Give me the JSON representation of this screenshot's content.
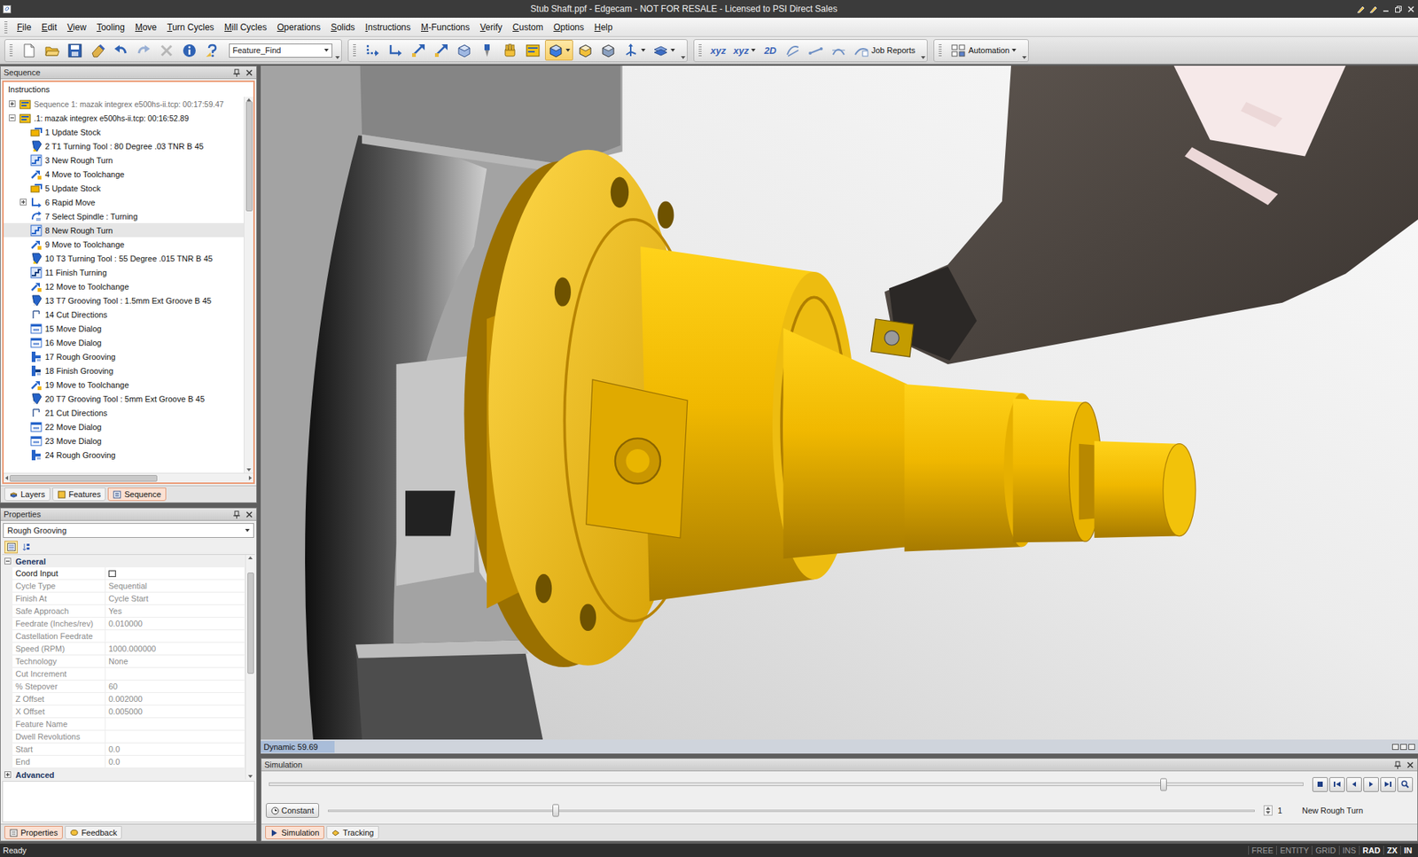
{
  "window": {
    "title": "Stub Shaft.ppf - Edgecam - NOT FOR RESALE - Licensed to PSI Direct Sales"
  },
  "menu": [
    "File",
    "Edit",
    "View",
    "Tooling",
    "Move",
    "Turn Cycles",
    "Mill Cycles",
    "Operations",
    "Solids",
    "Instructions",
    "M-Functions",
    "Verify",
    "Custom",
    "Options",
    "Help"
  ],
  "toolbar": {
    "groups": [
      {
        "items": [
          {
            "kind": "new",
            "label": "",
            "selected": false,
            "disabled": false,
            "dropdown": false
          },
          {
            "kind": "open",
            "label": "",
            "selected": false,
            "disabled": false,
            "dropdown": false
          },
          {
            "kind": "save",
            "label": "",
            "selected": false,
            "disabled": false,
            "dropdown": false
          },
          {
            "kind": "eraser",
            "label": "",
            "selected": false,
            "disabled": false,
            "dropdown": false
          },
          {
            "kind": "undo",
            "label": "",
            "selected": false,
            "disabled": false,
            "dropdown": false
          },
          {
            "kind": "redo",
            "label": "",
            "selected": false,
            "disabled": true,
            "dropdown": false
          },
          {
            "kind": "delete",
            "label": "",
            "selected": false,
            "disabled": true,
            "dropdown": false
          },
          {
            "kind": "info",
            "label": "",
            "selected": false,
            "disabled": false,
            "dropdown": false
          },
          {
            "kind": "help",
            "label": "",
            "selected": false,
            "disabled": false,
            "dropdown": false
          },
          {
            "kind": "combo",
            "label": "Feature_Find",
            "selected": false,
            "disabled": false,
            "dropdown": true
          }
        ]
      },
      {
        "items": [
          {
            "kind": "rapid",
            "label": "",
            "selected": false,
            "disabled": false,
            "dropdown": false
          },
          {
            "kind": "feed",
            "label": "",
            "selected": false,
            "disabled": false,
            "dropdown": false
          },
          {
            "kind": "arrows",
            "label": "",
            "selected": false,
            "disabled": false,
            "dropdown": false
          },
          {
            "kind": "arrows",
            "label": "",
            "selected": false,
            "disabled": false,
            "dropdown": false
          },
          {
            "kind": "cube-tool",
            "label": "",
            "selected": false,
            "disabled": false,
            "dropdown": false
          },
          {
            "kind": "drill",
            "label": "",
            "selected": false,
            "disabled": false,
            "dropdown": false
          },
          {
            "kind": "hand",
            "label": "",
            "selected": false,
            "disabled": false,
            "dropdown": false
          },
          {
            "kind": "nc",
            "label": "",
            "selected": false,
            "disabled": false,
            "dropdown": false
          },
          {
            "kind": "view-shaded",
            "label": "",
            "selected": true,
            "disabled": false,
            "dropdown": true
          },
          {
            "kind": "view-box",
            "label": "",
            "selected": false,
            "disabled": false,
            "dropdown": false
          },
          {
            "kind": "view-iso",
            "label": "",
            "selected": false,
            "disabled": false,
            "dropdown": false
          },
          {
            "kind": "axis",
            "label": "",
            "selected": false,
            "disabled": false,
            "dropdown": true
          },
          {
            "kind": "layer",
            "label": "",
            "selected": false,
            "disabled": false,
            "dropdown": true
          }
        ]
      },
      {
        "items": [
          {
            "kind": "text",
            "label": "xyz",
            "selected": false,
            "disabled": false,
            "dropdown": false
          },
          {
            "kind": "text",
            "label": "xyz",
            "selected": false,
            "disabled": false,
            "dropdown": true
          },
          {
            "kind": "text",
            "label": "2D",
            "selected": false,
            "disabled": false,
            "dropdown": false
          },
          {
            "kind": "curve",
            "label": "",
            "selected": false,
            "disabled": false,
            "dropdown": false
          },
          {
            "kind": "line",
            "label": "",
            "selected": false,
            "disabled": false,
            "dropdown": false
          },
          {
            "kind": "arc",
            "label": "",
            "selected": false,
            "disabled": false,
            "dropdown": false
          },
          {
            "kind": "reports",
            "label": "Job Reports",
            "selected": false,
            "disabled": false,
            "dropdown": false
          }
        ]
      },
      {
        "items": [
          {
            "kind": "automation",
            "label": "Automation",
            "selected": false,
            "disabled": false,
            "dropdown": true
          }
        ]
      }
    ]
  },
  "sequence_panel": {
    "title": "Sequence",
    "tree_header": "Instructions",
    "scroll": {
      "vertical_level": 0.3,
      "horizontal_level": 0.62
    },
    "sequences": [
      {
        "label": "Sequence 1: mazak integrex e500hs-ii.tcp: 00:17:59.47",
        "expanded": false,
        "active": false
      },
      {
        "label": ".1: mazak integrex e500hs-ii.tcp: 00:16:52.89",
        "expanded": true,
        "active": true
      }
    ],
    "items": [
      {
        "label": "1 Update Stock",
        "kind": "stock",
        "selected": false,
        "expandable": false,
        "expanded": false
      },
      {
        "label": "2 T1 Turning Tool : 80 Degree .03 TNR B 45",
        "kind": "tool",
        "selected": false,
        "expandable": false,
        "expanded": false
      },
      {
        "label": "3 New Rough Turn",
        "kind": "rough-turn",
        "selected": false,
        "expandable": false,
        "expanded": false
      },
      {
        "label": "4 Move to Toolchange",
        "kind": "toolchange",
        "selected": false,
        "expandable": false,
        "expanded": false
      },
      {
        "label": "5 Update Stock",
        "kind": "stock",
        "selected": false,
        "expandable": false,
        "expanded": false
      },
      {
        "label": "6 Rapid Move",
        "kind": "rapid",
        "selected": false,
        "expandable": true,
        "expanded": false
      },
      {
        "label": "7 Select Spindle : Turning",
        "kind": "spindle",
        "selected": false,
        "expandable": false,
        "expanded": false
      },
      {
        "label": "8 New Rough Turn",
        "kind": "rough-turn",
        "selected": true,
        "expandable": false,
        "expanded": false
      },
      {
        "label": "9 Move to Toolchange",
        "kind": "toolchange",
        "selected": false,
        "expandable": false,
        "expanded": false
      },
      {
        "label": "10 T3 Turning Tool : 55 Degree .015 TNR  B 45",
        "kind": "tool",
        "selected": false,
        "expandable": false,
        "expanded": false
      },
      {
        "label": "11 Finish Turning",
        "kind": "finish-turn",
        "selected": false,
        "expandable": false,
        "expanded": false
      },
      {
        "label": "12 Move to Toolchange",
        "kind": "toolchange",
        "selected": false,
        "expandable": false,
        "expanded": false
      },
      {
        "label": "13 T7 Grooving Tool : 1.5mm Ext Groove B 45",
        "kind": "groove-tool",
        "selected": false,
        "expandable": false,
        "expanded": false
      },
      {
        "label": "14 Cut Directions",
        "kind": "directions",
        "selected": false,
        "expandable": false,
        "expanded": false
      },
      {
        "label": "15 Move Dialog",
        "kind": "move-dialog",
        "selected": false,
        "expandable": false,
        "expanded": false
      },
      {
        "label": "16 Move Dialog",
        "kind": "move-dialog",
        "selected": false,
        "expandable": false,
        "expanded": false
      },
      {
        "label": "17 Rough Grooving",
        "kind": "rough-groove",
        "selected": false,
        "expandable": false,
        "expanded": false
      },
      {
        "label": "18 Finish Grooving",
        "kind": "finish-groove",
        "selected": false,
        "expandable": false,
        "expanded": false
      },
      {
        "label": "19 Move to Toolchange",
        "kind": "toolchange",
        "selected": false,
        "expandable": false,
        "expanded": false
      },
      {
        "label": "20 T7 Grooving Tool : 5mm Ext Groove B 45",
        "kind": "groove-tool",
        "selected": false,
        "expandable": false,
        "expanded": false
      },
      {
        "label": "21 Cut Directions",
        "kind": "directions",
        "selected": false,
        "expandable": false,
        "expanded": false
      },
      {
        "label": "22 Move Dialog",
        "kind": "move-dialog",
        "selected": false,
        "expandable": false,
        "expanded": false
      },
      {
        "label": "23 Move Dialog",
        "kind": "move-dialog",
        "selected": false,
        "expandable": false,
        "expanded": false
      },
      {
        "label": "24 Rough Grooving",
        "kind": "rough-groove",
        "selected": false,
        "expandable": false,
        "expanded": false
      }
    ],
    "tabs": [
      {
        "label": "Layers",
        "selected": false
      },
      {
        "label": "Features",
        "selected": false
      },
      {
        "label": "Sequence",
        "selected": true
      }
    ]
  },
  "properties_panel": {
    "title": "Properties",
    "object": "Rough Grooving",
    "scroll": {
      "vertical_level": 0.47
    },
    "tools": [
      {
        "kind": "categorized",
        "selected": true
      },
      {
        "kind": "alphabetical",
        "selected": false
      }
    ],
    "groups": [
      {
        "label": "General",
        "expanded": true,
        "rows": [
          {
            "name": "Coord Input",
            "value": "",
            "kind": "button",
            "enabled": true
          },
          {
            "name": "Cycle Type",
            "value": "Sequential",
            "kind": "text",
            "enabled": false
          },
          {
            "name": "Finish At",
            "value": "Cycle Start",
            "kind": "text",
            "enabled": false
          },
          {
            "name": "Safe Approach",
            "value": "Yes",
            "kind": "text",
            "enabled": false
          },
          {
            "name": "Feedrate (Inches/rev)",
            "value": "0.010000",
            "kind": "text",
            "enabled": false
          },
          {
            "name": "Castellation Feedrate",
            "value": "",
            "kind": "text",
            "enabled": false
          },
          {
            "name": "Speed (RPM)",
            "value": "1000.000000",
            "kind": "text",
            "enabled": false
          },
          {
            "name": "Technology",
            "value": "None",
            "kind": "text",
            "enabled": false
          },
          {
            "name": "Cut Increment",
            "value": "",
            "kind": "text",
            "enabled": false
          },
          {
            "name": "% Stepover",
            "value": "60",
            "kind": "text",
            "enabled": false
          },
          {
            "name": "Z Offset",
            "value": "0.002000",
            "kind": "text",
            "enabled": false
          },
          {
            "name": "X Offset",
            "value": "0.005000",
            "kind": "text",
            "enabled": false
          },
          {
            "name": "Feature Name",
            "value": "",
            "kind": "text",
            "enabled": false
          },
          {
            "name": "Dwell Revolutions",
            "value": "",
            "kind": "text",
            "enabled": false
          },
          {
            "name": "Start",
            "value": "0.0",
            "kind": "text",
            "enabled": false
          },
          {
            "name": "End",
            "value": "0.0",
            "kind": "text",
            "enabled": false
          }
        ]
      },
      {
        "label": "Advanced",
        "expanded": false,
        "rows": []
      }
    ],
    "tabs": [
      {
        "label": "Properties",
        "selected": true
      },
      {
        "label": "Feedback",
        "selected": false
      }
    ]
  },
  "viewport": {
    "status": "Dynamic 59.69"
  },
  "simulation": {
    "title": "Simulation",
    "progress": 0.865,
    "mode": "Constant",
    "speed": 0.245,
    "step": "1",
    "current": "New Rough Turn",
    "tabs": [
      {
        "label": "Simulation",
        "selected": true
      },
      {
        "label": "Tracking",
        "selected": false
      }
    ]
  },
  "status_bar": {
    "message": "Ready",
    "indicators": [
      {
        "label": "FREE",
        "on": false
      },
      {
        "label": "ENTITY",
        "on": false
      },
      {
        "label": "GRID",
        "on": false
      },
      {
        "label": "INS",
        "on": false
      },
      {
        "label": "RAD",
        "on": true
      },
      {
        "label": "ZX",
        "on": true
      },
      {
        "label": "IN",
        "on": true
      }
    ]
  }
}
